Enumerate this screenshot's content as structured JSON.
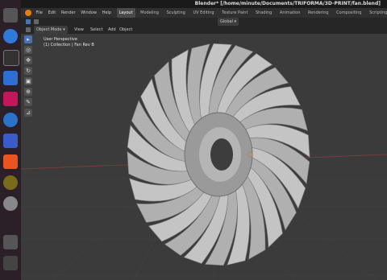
{
  "window": {
    "title": "Blender* [/home/minute/Documents/TRIFORMA/3D-PRINT/fan.blend]"
  },
  "menu": {
    "items": [
      "File",
      "Edit",
      "Render",
      "Window",
      "Help"
    ]
  },
  "workspaces": {
    "tabs": [
      "Layout",
      "Modeling",
      "Sculpting",
      "UV Editing",
      "Texture Paint",
      "Shading",
      "Animation",
      "Rendering",
      "Compositing",
      "Scripting"
    ],
    "add_label": "+",
    "active": "Layout"
  },
  "header": {
    "mode": "Object Mode",
    "view": "View",
    "select": "Select",
    "add": "Add",
    "object": "Object",
    "orientation": "Global"
  },
  "viewport": {
    "label": "User Perspective",
    "collection": "(1) Collection | Fan Rev B"
  },
  "dock": {
    "icons": [
      "files-icon",
      "browser-icon",
      "terminal-icon",
      "text-editor-icon",
      "office-icon",
      "help-icon",
      "screenshot-icon",
      "appstore-icon",
      "inkscape-icon",
      "settings-icon",
      "ufo-icon",
      "blender-icon"
    ]
  },
  "colors": {
    "accent": "#4772b3",
    "dock_bg": "#2b1f28",
    "viewport_bg": "#3b3b3b"
  }
}
